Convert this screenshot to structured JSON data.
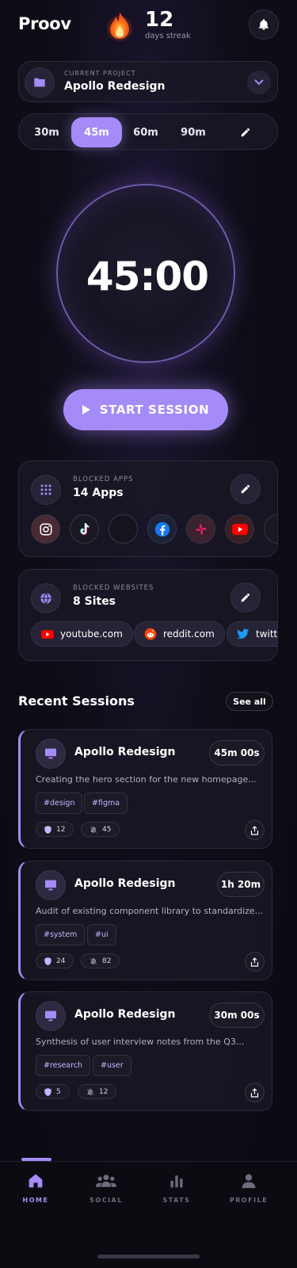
{
  "header": {
    "brand": "Proov",
    "streak_count": "12",
    "streak_label": "days streak"
  },
  "project": {
    "label": "CURRENT PROJECT",
    "name": "Apollo Redesign"
  },
  "durations": {
    "items": [
      "30m",
      "45m",
      "60m",
      "90m"
    ],
    "selected": "45m"
  },
  "timer": {
    "display": "45:00"
  },
  "start_button": {
    "label": "START SESSION"
  },
  "blocked_apps": {
    "label": "BLOCKED APPS",
    "value": "14 Apps",
    "apps": [
      "instagram-icon",
      "tiktok-icon",
      "app-placeholder-icon",
      "facebook-icon",
      "slack-icon",
      "youtube-icon"
    ]
  },
  "blocked_sites": {
    "label": "BLOCKED WEBSITES",
    "value": "8 Sites",
    "sites": [
      "youtube.com",
      "reddit.com",
      "twitt"
    ]
  },
  "recent": {
    "title": "Recent Sessions",
    "see_all": "See all",
    "sessions": [
      {
        "project": "Apollo Redesign",
        "duration": "45m 00s",
        "description": "Creating the hero section for the new homepage...",
        "tags": [
          "#design",
          "#figma"
        ],
        "blocks": "12",
        "mutes": "45"
      },
      {
        "project": "Apollo Redesign",
        "duration": "1h 20m",
        "description": "Audit of existing component library to standardize...",
        "tags": [
          "#system",
          "#ui"
        ],
        "blocks": "24",
        "mutes": "82"
      },
      {
        "project": "Apollo Redesign",
        "duration": "30m 00s",
        "description": "Synthesis of user interview notes from the Q3...",
        "tags": [
          "#research",
          "#user"
        ],
        "blocks": "5",
        "mutes": "12"
      }
    ]
  },
  "nav": {
    "items": [
      "HOME",
      "SOCIAL",
      "STATS",
      "PROFILE"
    ],
    "active": "HOME"
  },
  "colors": {
    "accent": "#a58bf7",
    "background": "#0f0d18"
  }
}
